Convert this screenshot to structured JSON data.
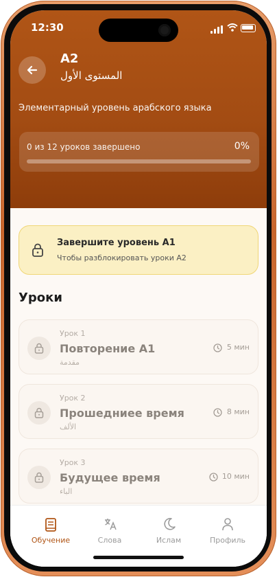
{
  "status": {
    "time": "12:30"
  },
  "header": {
    "level": "A2",
    "arabic_title": "المستوى الأول",
    "subtitle": "Элементарный уровень арабского языка",
    "progress": {
      "text": "0 из 12 уроков завершено",
      "percent_label": "0%",
      "fraction": 0
    }
  },
  "lock_banner": {
    "title": "Завершите уровень A1",
    "description": "Чтобы разблокировать уроки A2",
    "icon": "lock-icon"
  },
  "section_title": "Уроки",
  "lessons": [
    {
      "number": "Урок 1",
      "title": "Повторение A1",
      "arabic": "مقدمة",
      "duration": "5 мин"
    },
    {
      "number": "Урок 2",
      "title": "Прошедниее время",
      "arabic": "الألف",
      "duration": "8 мин"
    },
    {
      "number": "Урок 3",
      "title": "Будущее время",
      "arabic": "الباء",
      "duration": "10 мин"
    }
  ],
  "tabs": [
    {
      "label": "Обучение",
      "icon": "book-icon",
      "active": true
    },
    {
      "label": "Слова",
      "icon": "translate-icon",
      "active": false
    },
    {
      "label": "Ислам",
      "icon": "crescent-moon-icon",
      "active": false
    },
    {
      "label": "Профиль",
      "icon": "user-icon",
      "active": false
    }
  ],
  "colors": {
    "accent": "#b05516",
    "banner_bg": "#fbf0c4",
    "banner_border": "#f0d676"
  }
}
